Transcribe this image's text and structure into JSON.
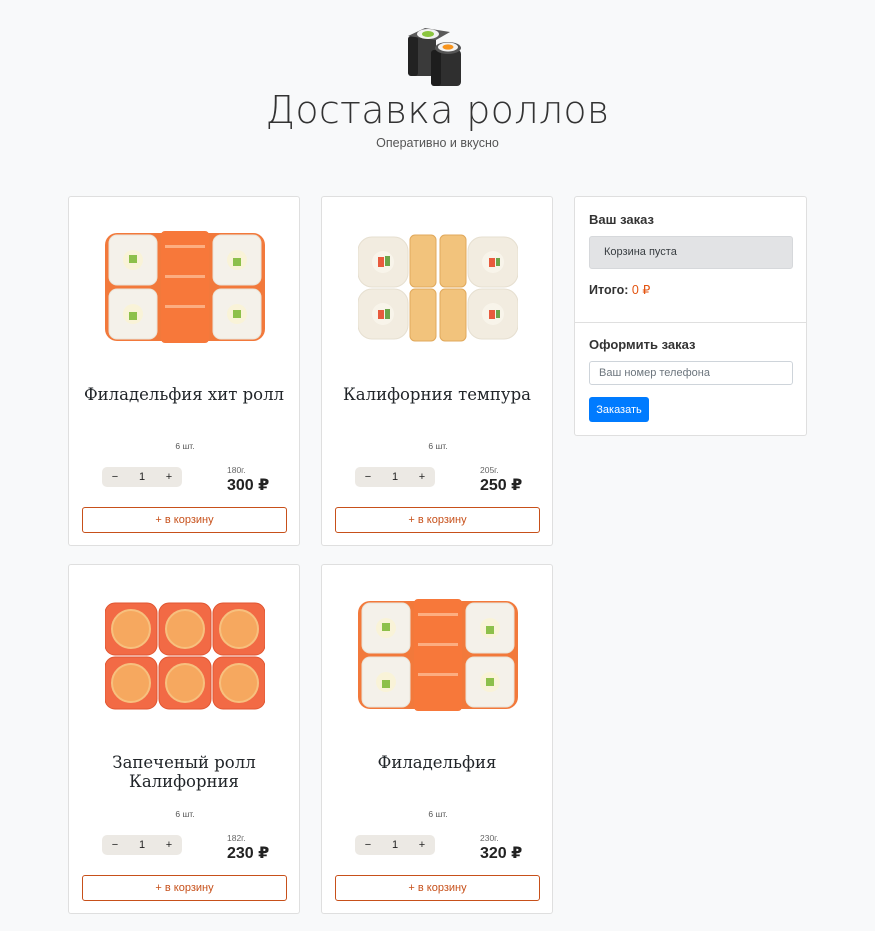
{
  "header": {
    "title": "Доставка роллов",
    "subtitle": "Оперативно и вкусно",
    "logo_icon": "sushi-rolls-icon"
  },
  "products": [
    {
      "name": "Филадельфия хит ролл",
      "pieces": "6 шт.",
      "count": "1",
      "weight": "180г.",
      "price": "300 ₽",
      "add_label": "+ в корзину",
      "image_icon": "philadelphia-hit-roll-image"
    },
    {
      "name": "Калифорния темпура",
      "pieces": "6 шт.",
      "count": "1",
      "weight": "205г.",
      "price": "250 ₽",
      "add_label": "+ в корзину",
      "image_icon": "california-tempura-image"
    },
    {
      "name": "Запеченый ролл Калифорния",
      "pieces": "6 шт.",
      "count": "1",
      "weight": "182г.",
      "price": "230 ₽",
      "add_label": "+ в корзину",
      "image_icon": "baked-california-roll-image"
    },
    {
      "name": "Филадельфия",
      "pieces": "6 шт.",
      "count": "1",
      "weight": "230г.",
      "price": "320 ₽",
      "add_label": "+ в корзину",
      "image_icon": "philadelphia-roll-image"
    }
  ],
  "counter": {
    "minus": "−",
    "plus": "+"
  },
  "order": {
    "title": "Ваш заказ",
    "empty_label": "Корзина пуста",
    "total_label": "Итого:",
    "total_value": "0 ₽",
    "checkout_title": "Оформить заказ",
    "phone_placeholder": "Ваш номер телефона",
    "phone_value": "",
    "submit_label": "Заказать"
  },
  "colors": {
    "accent": "#c7501a",
    "total": "#e3530f",
    "button": "#007bff"
  }
}
